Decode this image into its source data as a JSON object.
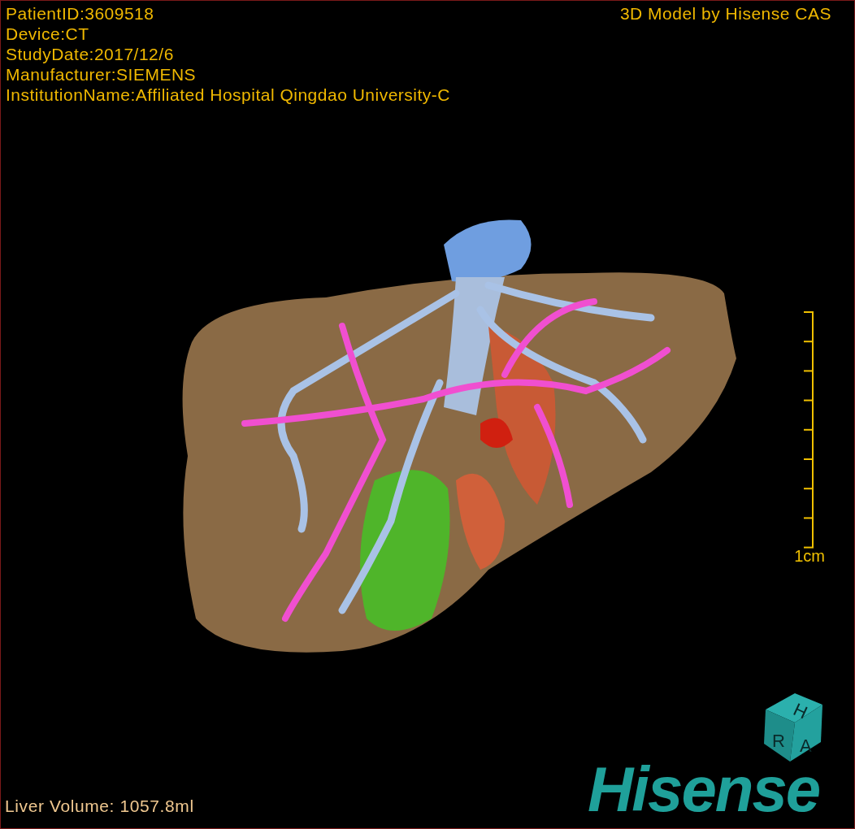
{
  "info_lines": [
    "PatientID:3609518",
    "Device:CT",
    "StudyDate:2017/12/6",
    "Manufacturer:SIEMENS",
    "InstitutionName:Affiliated Hospital Qingdao University-C"
  ],
  "title": "3D Model by Hisense CAS",
  "scale_bar": {
    "label": "1cm"
  },
  "volume": "Liver Volume: 1057.8ml",
  "orientation_cube": {
    "top": "H",
    "left": "R",
    "front": "A"
  },
  "logo": "Hisense"
}
